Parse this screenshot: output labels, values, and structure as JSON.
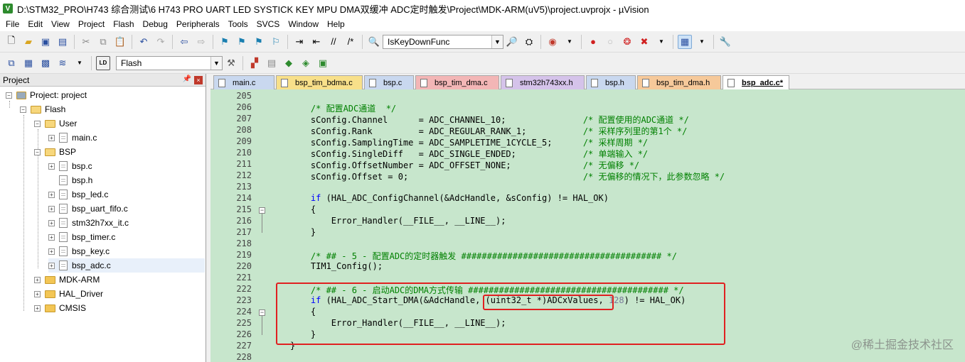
{
  "window": {
    "title": "D:\\STM32_PRO\\H743 综合测试\\6 H743 PRO UART LED SYSTICK KEY MPU DMA双缓冲 ADC定时触发\\Project\\MDK-ARM(uV5)\\project.uvprojx - µVision"
  },
  "menu": [
    "File",
    "Edit",
    "View",
    "Project",
    "Flash",
    "Debug",
    "Peripherals",
    "Tools",
    "SVCS",
    "Window",
    "Help"
  ],
  "toolbar": {
    "find_combo": "IsKeyDownFunc",
    "target_combo": "Flash"
  },
  "project_panel": {
    "title": "Project",
    "tree": [
      {
        "label": "Project: project",
        "level": 0
      },
      {
        "label": "Flash",
        "level": 1
      },
      {
        "label": "User",
        "level": 2
      },
      {
        "label": "main.c",
        "level": 3
      },
      {
        "label": "BSP",
        "level": 2
      },
      {
        "label": "bsp.c",
        "level": 3
      },
      {
        "label": "bsp.h",
        "level": 3
      },
      {
        "label": "bsp_led.c",
        "level": 3
      },
      {
        "label": "bsp_uart_fifo.c",
        "level": 3
      },
      {
        "label": "stm32h7xx_it.c",
        "level": 3
      },
      {
        "label": "bsp_timer.c",
        "level": 3
      },
      {
        "label": "bsp_key.c",
        "level": 3
      },
      {
        "label": "bsp_adc.c",
        "level": 3
      },
      {
        "label": "MDK-ARM",
        "level": 2
      },
      {
        "label": "HAL_Driver",
        "level": 2
      },
      {
        "label": "CMSIS",
        "level": 2
      }
    ]
  },
  "tabs": [
    {
      "label": "main.c",
      "color": "#c9d8ef"
    },
    {
      "label": "bsp_tim_bdma.c",
      "color": "#f8e08a"
    },
    {
      "label": "bsp.c",
      "color": "#c9d8ef"
    },
    {
      "label": "bsp_tim_dma.c",
      "color": "#f3b6b6"
    },
    {
      "label": "stm32h743xx.h",
      "color": "#d5c3ea"
    },
    {
      "label": "bsp.h",
      "color": "#c9d8ef"
    },
    {
      "label": "bsp_tim_dma.h",
      "color": "#f6c99a"
    },
    {
      "label": "bsp_adc.c*",
      "color": "#ffffff"
    }
  ],
  "code": {
    "line_numbers": [
      "205",
      "206",
      "207",
      "208",
      "209",
      "210",
      "211",
      "212",
      "213",
      "214",
      "215",
      "216",
      "217",
      "218",
      "219",
      "220",
      "221",
      "222",
      "223",
      "224",
      "225",
      "226",
      "227",
      "228"
    ],
    "lines": [
      "",
      "    /* 配置ADC通道  */",
      "    sConfig.Channel      = ADC_CHANNEL_10;               /* 配置使用的ADC通道 */",
      "    sConfig.Rank         = ADC_REGULAR_RANK_1;           /* 采样序列里的第1个 */",
      "    sConfig.SamplingTime = ADC_SAMPLETIME_1CYCLE_5;      /* 采样周期 */",
      "    sConfig.SingleDiff   = ADC_SINGLE_ENDED;             /* 单端输入 */",
      "    sConfig.OffsetNumber = ADC_OFFSET_NONE;              /* 无偏移 */",
      "    sConfig.Offset = 0;                                  /* 无偏移的情况下，此参数忽略 */",
      "",
      "    if (HAL_ADC_ConfigChannel(&AdcHandle, &sConfig) != HAL_OK)",
      "    {",
      "        Error_Handler(__FILE__, __LINE__);",
      "    }",
      "",
      "    /* ## - 5 - 配置ADC的定时器触发 ####################################### */",
      "    TIM1_Config();",
      "",
      "    /* ## - 6 - 启动ADC的DMA方式传输 ####################################### */",
      "    if (HAL_ADC_Start_DMA(&AdcHandle, (uint32_t *)ADCxValues, 128) != HAL_OK)",
      "    {",
      "        Error_Handler(__FILE__, __LINE__);",
      "    }",
      "}",
      ""
    ]
  },
  "watermark": "@稀土掘金技术社区"
}
